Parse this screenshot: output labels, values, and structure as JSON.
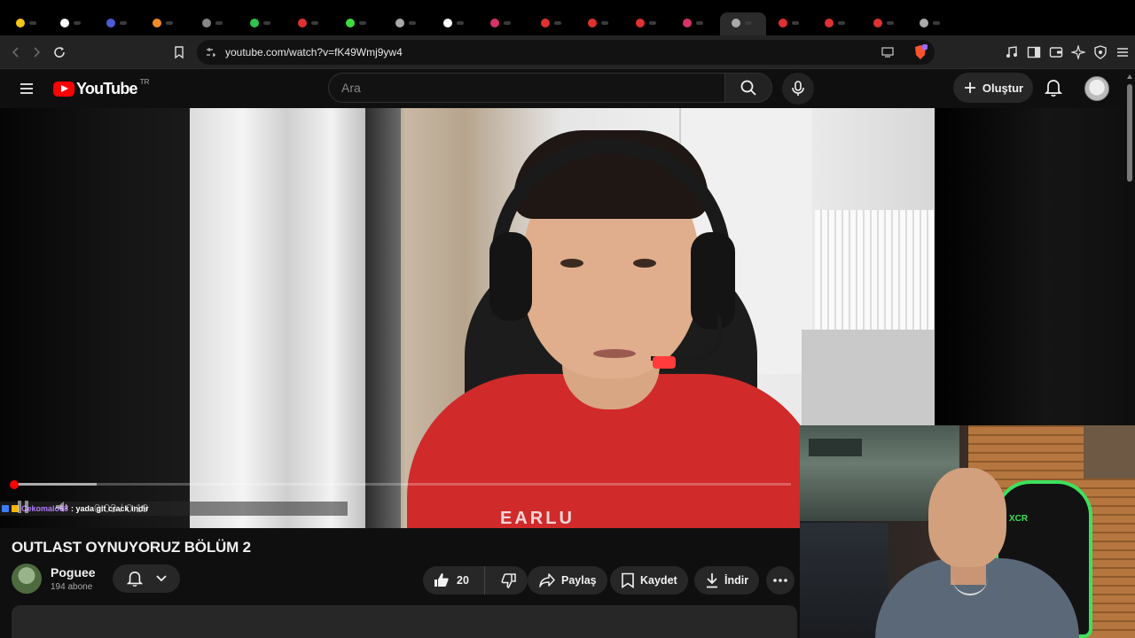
{
  "browser": {
    "url": "youtube.com/watch?v=fK49Wmj9yw4",
    "tab_favicon_colors": [
      "#f5c518",
      "#ffffff",
      "#4b5bd6",
      "#f28c28",
      "#888888",
      "#2ec44b",
      "#e03131",
      "#3ddc3d",
      "#aaaaaa",
      "#ffffff",
      "#d6336c",
      "#e03131",
      "#e03131",
      "#e03131",
      "#d6336c",
      "#aaaaaa",
      "#e03131",
      "#e03131",
      "#e03131",
      "#aaaaaa"
    ]
  },
  "masthead": {
    "logo_text": "YouTube",
    "country_code": "TR",
    "search_placeholder": "Ara",
    "create_label": "Oluştur"
  },
  "player": {
    "time_display": "0:03 / 0:19",
    "progress_fraction": 0.004,
    "buffered_fraction": 0.11,
    "shirt_text": "EARLU",
    "chat": {
      "username": "Cekomalo68",
      "message": ": yada git crack indir"
    }
  },
  "video": {
    "title": "OUTLAST OYNUYORUZ BÖLÜM 2",
    "channel_name": "Poguee",
    "subscriber_count": "194 abone",
    "like_count": "20",
    "share_label": "Paylaş",
    "save_label": "Kaydet",
    "download_label": "İndir"
  },
  "webcam": {
    "chair_brand": "XCR"
  },
  "colors": {
    "youtube_red": "#ff0000",
    "chair_accent": "#3ee05c",
    "chat_username": "#b57bff"
  }
}
